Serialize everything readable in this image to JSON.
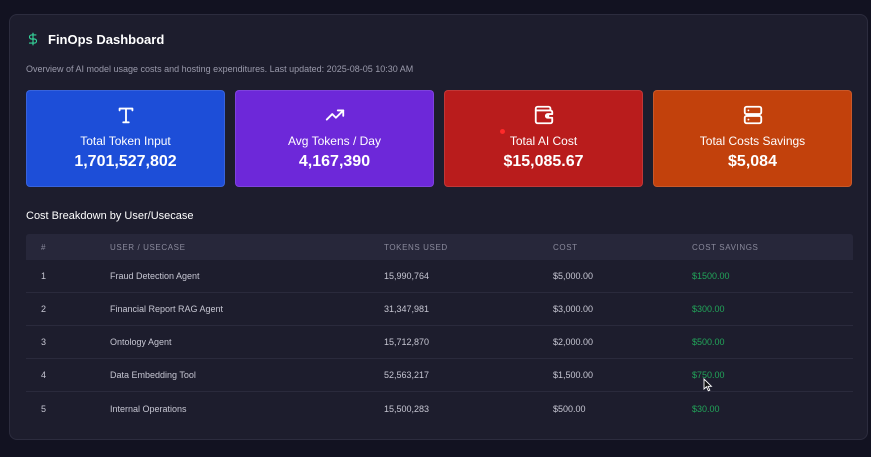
{
  "app": {
    "title": "FinOps Dashboard",
    "subtitle": "Overview of AI model usage costs and hosting expenditures. Last updated: 2025-08-05 10:30 AM",
    "accent": "#34d399"
  },
  "cards": [
    {
      "label": "Total Token Input",
      "value": "1,701,527,802",
      "icon": "text-icon",
      "color": "#1d4ed8"
    },
    {
      "label": "Avg Tokens / Day",
      "value": "4,167,390",
      "icon": "trending-up-icon",
      "color": "#6d28d9"
    },
    {
      "label": "Total AI Cost",
      "value": "$15,085.67",
      "icon": "wallet-icon",
      "color": "#b91c1c"
    },
    {
      "label": "Total Costs Savings",
      "value": "$5,084",
      "icon": "server-icon",
      "color": "#c2410c"
    }
  ],
  "breakdown": {
    "title": "Cost Breakdown by User/Usecase",
    "columns": [
      "#",
      "USER / USECASE",
      "TOKENS USED",
      "COST",
      "COST SAVINGS"
    ],
    "rows": [
      {
        "num": "1",
        "usecase": "Fraud Detection Agent",
        "tokens": "15,990,764",
        "cost": "$5,000.00",
        "savings": "$1500.00"
      },
      {
        "num": "2",
        "usecase": "Financial Report RAG Agent",
        "tokens": "31,347,981",
        "cost": "$3,000.00",
        "savings": "$300.00"
      },
      {
        "num": "3",
        "usecase": "Ontology Agent",
        "tokens": "15,712,870",
        "cost": "$2,000.00",
        "savings": "$500.00"
      },
      {
        "num": "4",
        "usecase": "Data Embedding Tool",
        "tokens": "52,563,217",
        "cost": "$1,500.00",
        "savings": "$750.00"
      },
      {
        "num": "5",
        "usecase": "Internal Operations",
        "tokens": "15,500,283",
        "cost": "$500.00",
        "savings": "$30.00"
      }
    ]
  }
}
